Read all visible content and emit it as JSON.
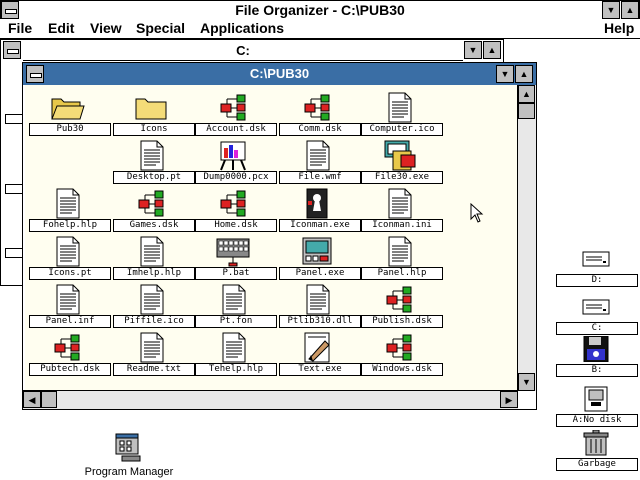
{
  "title_bar": {
    "title": "File Organizer - C:\\PUB30"
  },
  "menu": {
    "file": "File",
    "edit": "Edit",
    "view": "View",
    "special": "Special",
    "applications": "Applications",
    "help": "Help"
  },
  "drive_window": {
    "title": "C:"
  },
  "main_window": {
    "title": "C:\\PUB30",
    "files": [
      {
        "name": "Pub30",
        "icon": "folder-open-icon"
      },
      {
        "name": "Icons",
        "icon": "folder-icon"
      },
      {
        "name": "Account.dsk",
        "icon": "network-icon"
      },
      {
        "name": "Comm.dsk",
        "icon": "network-icon"
      },
      {
        "name": "Computer.ico",
        "icon": "document-icon"
      },
      {
        "name": "Desktop.pt",
        "icon": "document-icon"
      },
      {
        "name": "Dump0000.pcx",
        "icon": "easel-icon"
      },
      {
        "name": "File.wmf",
        "icon": "document-icon"
      },
      {
        "name": "File30.exe",
        "icon": "file-app-icon"
      },
      {
        "name": "Fohelp.hlp",
        "icon": "document-icon"
      },
      {
        "name": "Games.dsk",
        "icon": "network-icon"
      },
      {
        "name": "Home.dsk",
        "icon": "network-icon"
      },
      {
        "name": "Iconman.exe",
        "icon": "keyhole-icon"
      },
      {
        "name": "Iconman.ini",
        "icon": "document-icon"
      },
      {
        "name": "Icons.pt",
        "icon": "document-icon"
      },
      {
        "name": "Imhelp.hlp",
        "icon": "document-icon"
      },
      {
        "name": "P.bat",
        "icon": "keyboard-icon"
      },
      {
        "name": "Panel.exe",
        "icon": "panel-icon"
      },
      {
        "name": "Panel.hlp",
        "icon": "document-icon"
      },
      {
        "name": "Panel.inf",
        "icon": "document-icon"
      },
      {
        "name": "Piffile.ico",
        "icon": "document-icon"
      },
      {
        "name": "Pt.fon",
        "icon": "document-icon"
      },
      {
        "name": "Ptlib310.dll",
        "icon": "document-icon"
      },
      {
        "name": "Publish.dsk",
        "icon": "network-icon"
      },
      {
        "name": "Pubtech.dsk",
        "icon": "network-icon"
      },
      {
        "name": "Readme.txt",
        "icon": "document-icon"
      },
      {
        "name": "Tehelp.hlp",
        "icon": "document-icon"
      },
      {
        "name": "Text.exe",
        "icon": "pen-icon"
      },
      {
        "name": "Windows.dsk",
        "icon": "network-icon"
      }
    ]
  },
  "drives": [
    {
      "label": "D:",
      "icon": "hard-drive-icon"
    },
    {
      "label": "C:",
      "icon": "hard-drive-icon"
    },
    {
      "label": "B:",
      "icon": "floppy-disk-icon"
    },
    {
      "label": "A:No disk",
      "icon": "floppy-empty-icon"
    },
    {
      "label": "Garbage",
      "icon": "trash-can-icon"
    }
  ],
  "program_manager": {
    "label": "Program Manager",
    "icon": "program-manager-icon"
  },
  "colors": {
    "title_active": "#3a6ea5",
    "content_bg": "#fffef0",
    "chrome": "#c0c0c0"
  }
}
